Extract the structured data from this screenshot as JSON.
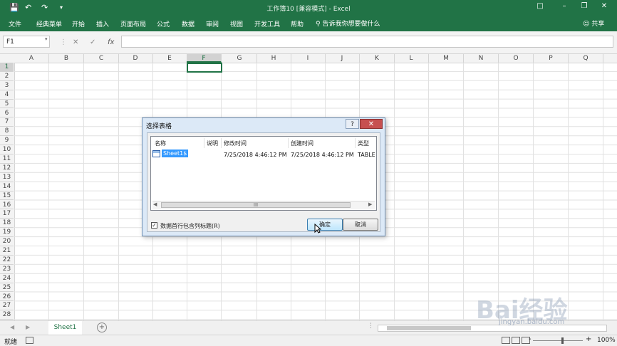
{
  "titlebar": {
    "title": "工作簿10  [兼容模式]  -  Excel",
    "save_icon": "save-icon",
    "undo_icon": "undo-icon",
    "redo_icon": "redo-icon"
  },
  "ribbon": {
    "tabs": [
      "文件",
      "经典菜单",
      "开始",
      "插入",
      "页面布局",
      "公式",
      "数据",
      "审阅",
      "视图",
      "开发工具",
      "帮助"
    ],
    "tell_me": "告诉我你想要做什么",
    "share": "共享"
  },
  "formula_bar": {
    "name_box": "F1",
    "cancel_symbol": "✕",
    "enter_symbol": "✓",
    "fx_symbol": "fx",
    "formula": ""
  },
  "grid": {
    "columns": [
      "A",
      "B",
      "C",
      "D",
      "E",
      "F",
      "G",
      "H",
      "I",
      "J",
      "K",
      "L",
      "M",
      "N",
      "O",
      "P",
      "Q"
    ],
    "rows": [
      "1",
      "2",
      "3",
      "4",
      "5",
      "6",
      "7",
      "8",
      "9",
      "10",
      "11",
      "12",
      "13",
      "14",
      "15",
      "16",
      "17",
      "18",
      "19",
      "20",
      "21",
      "22",
      "23",
      "24",
      "25",
      "26",
      "27",
      "28"
    ],
    "selected_cell": "F1"
  },
  "dialog": {
    "title": "选择表格",
    "help_label": "?",
    "close_label": "✕",
    "columns": [
      "名称",
      "说明",
      "修改时间",
      "创建时间",
      "类型"
    ],
    "rows": [
      {
        "name": "Sheet1$",
        "description": "",
        "modified": "7/25/2018 4:46:12 PM",
        "created": "7/25/2018 4:46:12 PM",
        "type": "TABLE"
      }
    ],
    "scroll_grip": "III",
    "checkbox_label": "数据首行包含列标题(R)",
    "checkbox_checked": true,
    "ok_label": "确定",
    "cancel_label": "取消"
  },
  "sheetbar": {
    "sheets": [
      "Sheet1"
    ],
    "add_label": "+"
  },
  "statusbar": {
    "status": "就绪",
    "zoom": "100%",
    "zoom_minus": "-",
    "zoom_plus": "+"
  },
  "watermark": {
    "text": "Bai经验",
    "url": "jingyan.baidu.com"
  },
  "colors": {
    "accent": "#217346",
    "dialog_bg": "#dce9f7",
    "selection": "#3399ff"
  }
}
